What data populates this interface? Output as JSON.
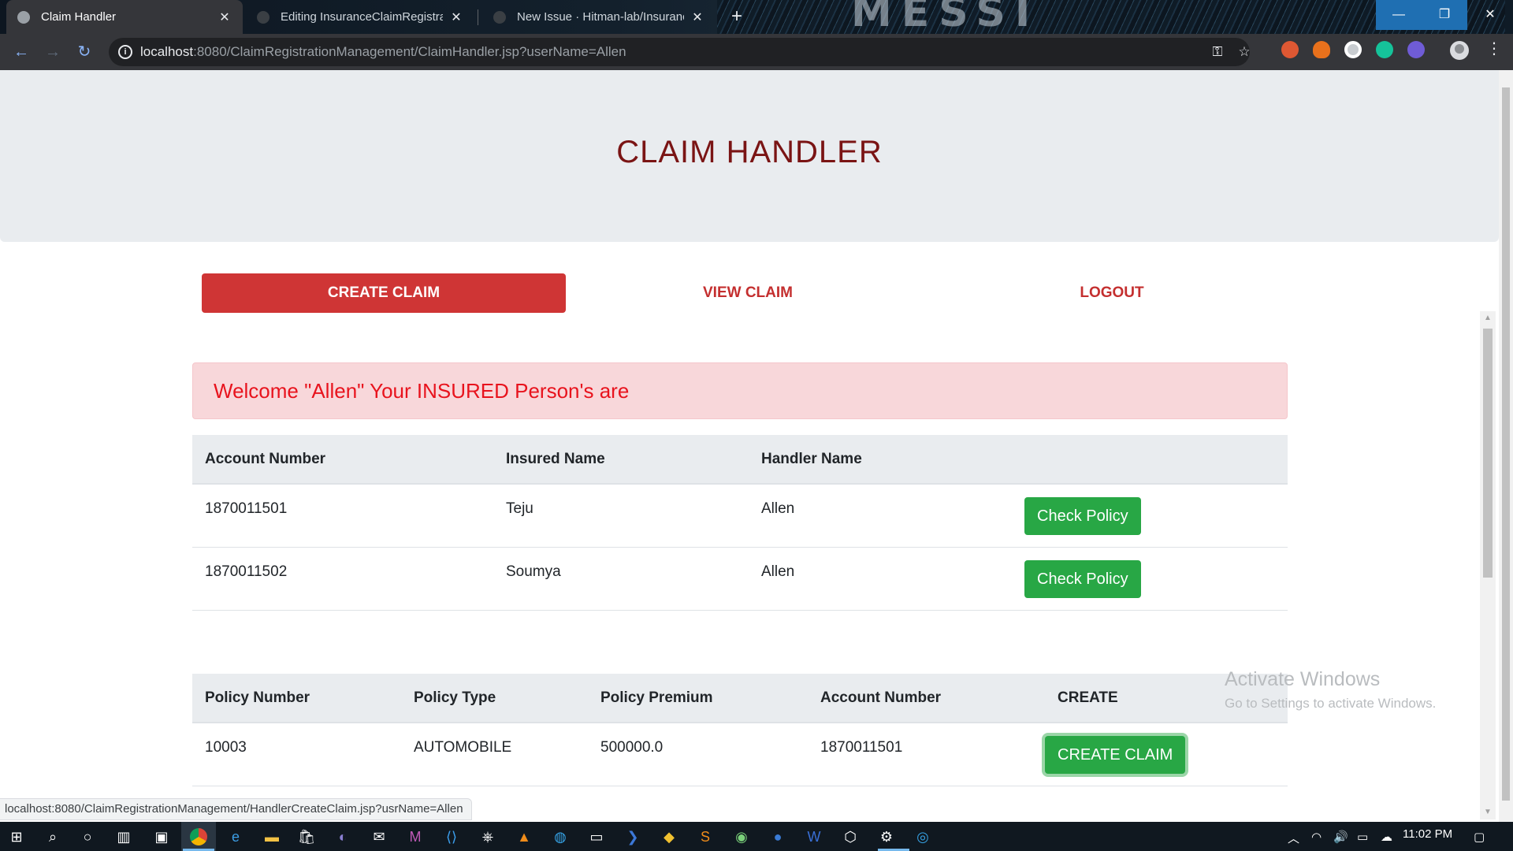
{
  "browser": {
    "tabs": [
      {
        "title": "Claim Handler",
        "active": true
      },
      {
        "title": "Editing InsuranceClaimRegistrat",
        "active": false
      },
      {
        "title": "New Issue · Hitman-lab/Insuranc",
        "active": false
      }
    ],
    "url_host": "localhost",
    "url_rest": ":8080/ClaimRegistrationManagement/ClaimHandler.jsp?userName=Allen",
    "status_url": "localhost:8080/ClaimRegistrationManagement/HandlerCreateClaim.jsp?usrName=Allen",
    "wallpaper_text": "MESSI"
  },
  "page": {
    "title": "CLAIM HANDLER",
    "nav": {
      "create": "CREATE CLAIM",
      "view": "VIEW CLAIM",
      "logout": "LOGOUT"
    },
    "welcome": "Welcome \"Allen\" Your INSURED Person's are",
    "accounts_table": {
      "headers": [
        "Account Number",
        "Insured Name",
        "Handler Name"
      ],
      "rows": [
        {
          "account": "1870011501",
          "insured": "Teju",
          "handler": "Allen",
          "action": "Check Policy"
        },
        {
          "account": "1870011502",
          "insured": "Soumya",
          "handler": "Allen",
          "action": "Check Policy"
        }
      ]
    },
    "policy_table": {
      "headers": [
        "Policy Number",
        "Policy Type",
        "Policy Premium",
        "Account Number",
        "CREATE"
      ],
      "rows": [
        {
          "policy": "10003",
          "type": "AUTOMOBILE",
          "premium": "500000.0",
          "account": "1870011501",
          "action": "CREATE CLAIM"
        }
      ]
    }
  },
  "watermark": {
    "line1": "Activate Windows",
    "line2": "Go to Settings to activate Windows."
  },
  "taskbar": {
    "clock": "11:02 PM"
  },
  "colors": {
    "title": "#7a1414",
    "nav_red": "#cf3535",
    "alert_bg": "#f8d7da",
    "alert_text": "#e8131d",
    "success": "#28a745"
  }
}
